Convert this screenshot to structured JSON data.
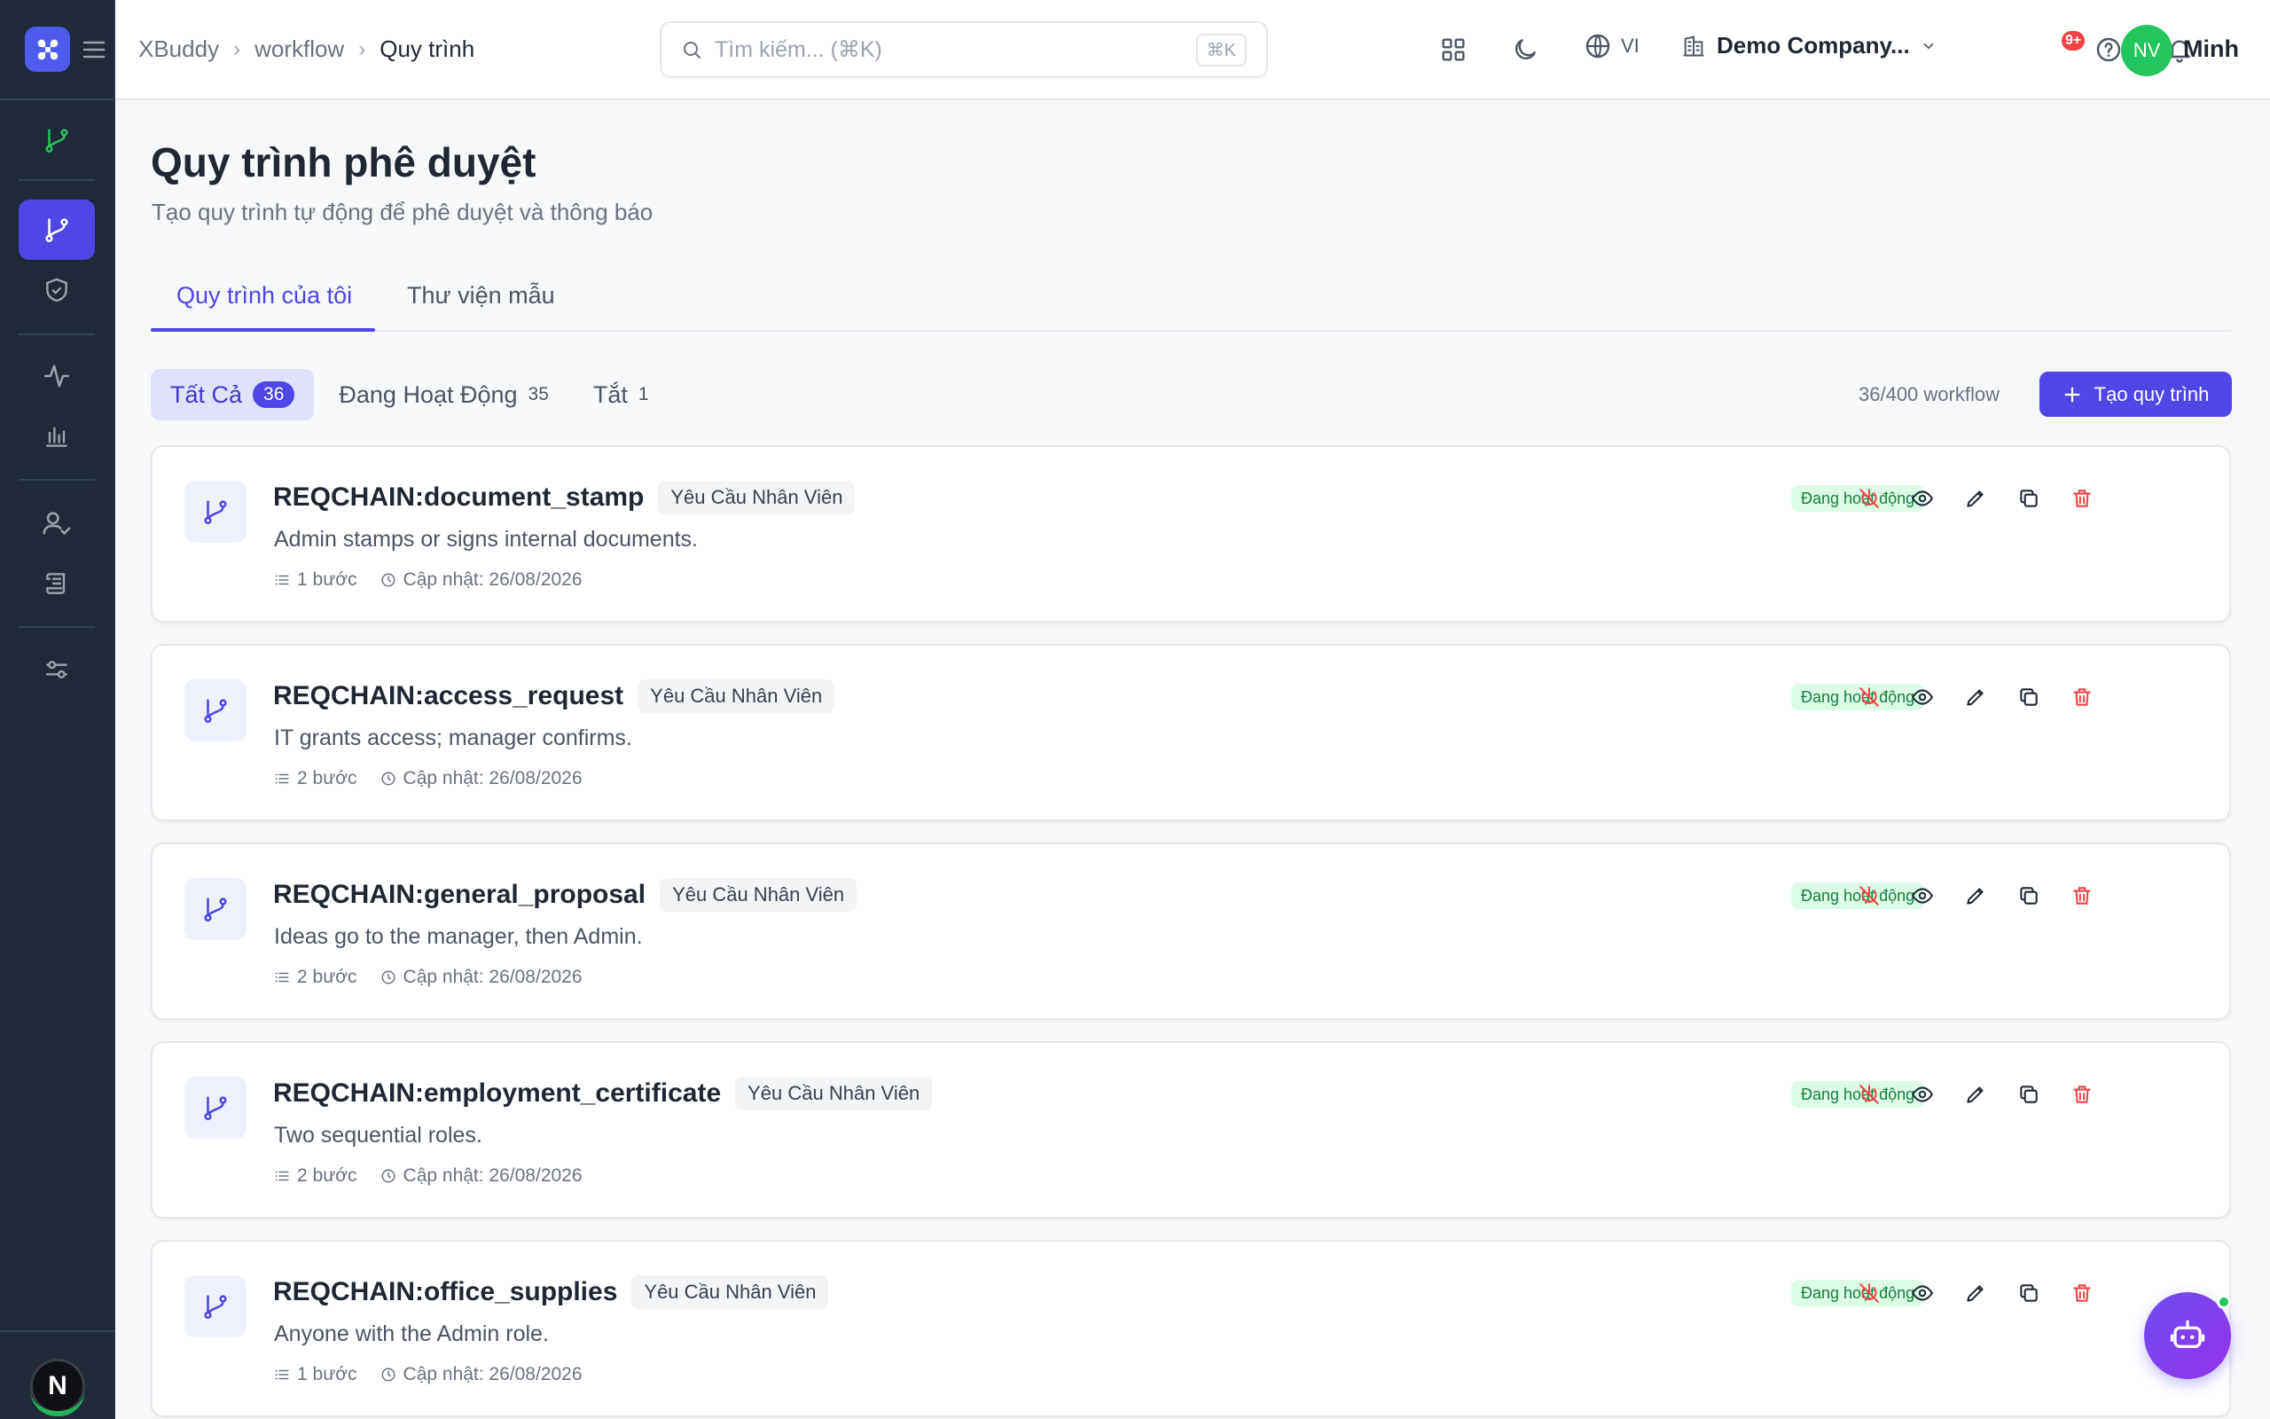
{
  "header": {
    "breadcrumb": [
      "XBuddy",
      "workflow",
      "Quy trình"
    ],
    "search_placeholder": "Tìm kiếm... (⌘K)",
    "search_shortcut": "⌘K",
    "language": "VI",
    "company": "Demo Company...",
    "notification_badge": "9+",
    "user_initials": "NV",
    "user_name": "Minh"
  },
  "page": {
    "title": "Quy trình phê duyệt",
    "subtitle": "Tạo quy trình tự động để phê duyệt và thông báo"
  },
  "tabs": [
    {
      "label": "Quy trình của tôi",
      "active": true
    },
    {
      "label": "Thư viện mẫu",
      "active": false
    }
  ],
  "filters": [
    {
      "label": "Tất Cả",
      "count": "36",
      "active": true
    },
    {
      "label": "Đang Hoạt Động",
      "count": "35",
      "active": false
    },
    {
      "label": "Tắt",
      "count": "1",
      "active": false
    }
  ],
  "quota": "36/400 workflow",
  "create_button": "Tạo quy trình",
  "workflows": [
    {
      "name": "REQCHAIN:document_stamp",
      "tag": "Yêu Cầu Nhân Viên",
      "description": "Admin stamps or signs internal documents.",
      "steps": "1 bước",
      "updated": "Cập nhật: 26/08/2026",
      "status": "Đang hoạt động"
    },
    {
      "name": "REQCHAIN:access_request",
      "tag": "Yêu Cầu Nhân Viên",
      "description": "IT grants access; manager confirms.",
      "steps": "2 bước",
      "updated": "Cập nhật: 26/08/2026",
      "status": "Đang hoạt động"
    },
    {
      "name": "REQCHAIN:general_proposal",
      "tag": "Yêu Cầu Nhân Viên",
      "description": "Ideas go to the manager, then Admin.",
      "steps": "2 bước",
      "updated": "Cập nhật: 26/08/2026",
      "status": "Đang hoạt động"
    },
    {
      "name": "REQCHAIN:employment_certificate",
      "tag": "Yêu Cầu Nhân Viên",
      "description": "Two sequential roles.",
      "steps": "2 bước",
      "updated": "Cập nhật: 26/08/2026",
      "status": "Đang hoạt động"
    },
    {
      "name": "REQCHAIN:office_supplies",
      "tag": "Yêu Cầu Nhân Viên",
      "description": "Anyone with the Admin role.",
      "steps": "1 bước",
      "updated": "Cập nhật: 26/08/2026",
      "status": "Đang hoạt động"
    }
  ],
  "sidebar_avatar": "N",
  "colors": {
    "accent": "#4f46e5",
    "sidebar": "#1f2937",
    "status_bg": "#dcfce7",
    "status_text": "#15803d",
    "danger": "#ef4444"
  }
}
